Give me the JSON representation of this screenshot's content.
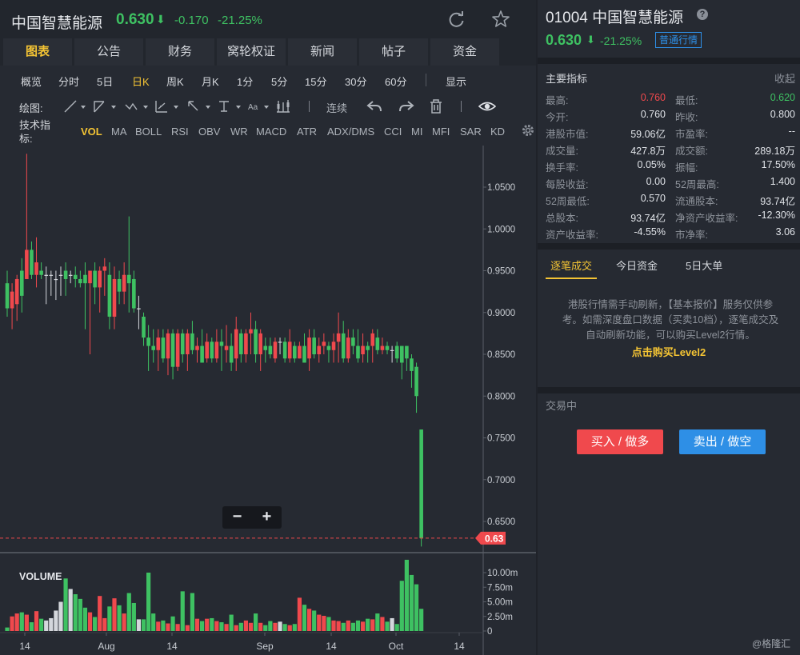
{
  "header": {
    "name": "中国智慧能源",
    "price": "0.630",
    "arrow": "⬇",
    "change": "-0.170",
    "change_pct": "-21.25%"
  },
  "tabs": [
    {
      "label": "图表",
      "active": true
    },
    {
      "label": "公告"
    },
    {
      "label": "财务"
    },
    {
      "label": "窝轮权证"
    },
    {
      "label": "新闻"
    },
    {
      "label": "帖子"
    },
    {
      "label": "资金"
    }
  ],
  "periods": [
    {
      "label": "概览"
    },
    {
      "label": "分时"
    },
    {
      "label": "5日"
    },
    {
      "label": "日K",
      "active": true
    },
    {
      "label": "周K"
    },
    {
      "label": "月K"
    },
    {
      "label": "1分"
    },
    {
      "label": "5分"
    },
    {
      "label": "15分"
    },
    {
      "label": "30分"
    },
    {
      "label": "60分"
    },
    {
      "label": "显示"
    }
  ],
  "drawbar": {
    "label": "绘图:",
    "continuous": "连续"
  },
  "indicators": {
    "label": "技术指标:",
    "items": [
      "VOL",
      "MA",
      "BOLL",
      "RSI",
      "OBV",
      "WR",
      "MACD",
      "ATR",
      "ADX/DMS",
      "CCI",
      "MI",
      "MFI",
      "SAR",
      "KD"
    ],
    "active": "VOL"
  },
  "chart_data": {
    "type": "candlestick",
    "price_axis": {
      "ticks": [
        "1.0500",
        "1.0000",
        "0.9500",
        "0.9000",
        "0.8500",
        "0.8000",
        "0.7500",
        "0.7000",
        "0.6500"
      ],
      "range": [
        0.62,
        1.08
      ]
    },
    "current_price_label": "0.63",
    "volume_label": "VOLUME",
    "volume_axis": {
      "ticks": [
        "10.00m",
        "7.50m",
        "5.00m",
        "2.50m",
        "0"
      ],
      "range": [
        0,
        13
      ]
    },
    "x_labels": [
      "14",
      "Aug",
      "14",
      "Sep",
      "14",
      "Oct",
      "14"
    ],
    "candles": [
      {
        "o": 0.935,
        "h": 0.95,
        "l": 0.895,
        "c": 0.905,
        "v": 0.6
      },
      {
        "o": 0.905,
        "h": 0.935,
        "l": 0.88,
        "c": 0.925,
        "v": 2.5
      },
      {
        "o": 0.91,
        "h": 0.945,
        "l": 0.89,
        "c": 0.94,
        "v": 3.0
      },
      {
        "o": 0.95,
        "h": 0.965,
        "l": 0.9,
        "c": 0.92,
        "v": 3.2
      },
      {
        "o": 0.94,
        "h": 1.09,
        "l": 0.94,
        "c": 0.975,
        "v": 2.8
      },
      {
        "o": 0.975,
        "h": 0.985,
        "l": 0.94,
        "c": 0.945,
        "v": 1.5
      },
      {
        "o": 0.945,
        "h": 0.99,
        "l": 0.93,
        "c": 0.96,
        "v": 3.4
      },
      {
        "o": 0.95,
        "h": 0.96,
        "l": 0.94,
        "c": 0.945,
        "v": 2.1
      },
      {
        "o": 0.945,
        "h": 0.955,
        "l": 0.91,
        "c": 0.945,
        "v": 1.8
      },
      {
        "o": 0.945,
        "h": 0.95,
        "l": 0.92,
        "c": 0.945,
        "v": 2.2
      },
      {
        "o": 0.94,
        "h": 0.95,
        "l": 0.915,
        "c": 0.94,
        "v": 3.5
      },
      {
        "o": 0.945,
        "h": 0.955,
        "l": 0.92,
        "c": 0.945,
        "v": 5.0
      },
      {
        "o": 0.95,
        "h": 0.96,
        "l": 0.92,
        "c": 0.94,
        "v": 9.0
      },
      {
        "o": 0.945,
        "h": 0.95,
        "l": 0.935,
        "c": 0.945,
        "v": 7.2
      },
      {
        "o": 0.945,
        "h": 0.955,
        "l": 0.93,
        "c": 0.94,
        "v": 6.3
      },
      {
        "o": 0.94,
        "h": 0.95,
        "l": 0.93,
        "c": 0.935,
        "v": 5.5
      },
      {
        "o": 0.945,
        "h": 0.96,
        "l": 0.88,
        "c": 0.935,
        "v": 4.0
      },
      {
        "o": 0.935,
        "h": 0.95,
        "l": 0.85,
        "c": 0.95,
        "v": 3.2
      },
      {
        "o": 0.95,
        "h": 0.96,
        "l": 0.91,
        "c": 0.93,
        "v": 2.4
      },
      {
        "o": 0.93,
        "h": 0.955,
        "l": 0.9,
        "c": 0.95,
        "v": 6.0
      },
      {
        "o": 0.95,
        "h": 0.965,
        "l": 0.92,
        "c": 0.955,
        "v": 2.2
      },
      {
        "o": 0.945,
        "h": 0.96,
        "l": 0.88,
        "c": 0.895,
        "v": 4.2
      },
      {
        "o": 0.895,
        "h": 0.955,
        "l": 0.88,
        "c": 0.94,
        "v": 5.6
      },
      {
        "o": 0.94,
        "h": 0.95,
        "l": 0.91,
        "c": 0.925,
        "v": 4.4
      },
      {
        "o": 0.925,
        "h": 0.96,
        "l": 0.91,
        "c": 0.945,
        "v": 3.0
      },
      {
        "o": 0.945,
        "h": 1.015,
        "l": 0.9,
        "c": 0.935,
        "v": 6.5
      },
      {
        "o": 0.94,
        "h": 0.95,
        "l": 0.9,
        "c": 0.905,
        "v": 4.8
      },
      {
        "o": 0.905,
        "h": 0.92,
        "l": 0.88,
        "c": 0.905,
        "v": 2.0
      },
      {
        "o": 0.895,
        "h": 0.9,
        "l": 0.86,
        "c": 0.87,
        "v": 2.0
      },
      {
        "o": 0.87,
        "h": 0.885,
        "l": 0.83,
        "c": 0.86,
        "v": 10.0
      },
      {
        "o": 0.86,
        "h": 0.88,
        "l": 0.84,
        "c": 0.855,
        "v": 3.0
      },
      {
        "o": 0.855,
        "h": 0.88,
        "l": 0.83,
        "c": 0.87,
        "v": 1.6
      },
      {
        "o": 0.87,
        "h": 0.88,
        "l": 0.84,
        "c": 0.845,
        "v": 1.8
      },
      {
        "o": 0.845,
        "h": 0.88,
        "l": 0.825,
        "c": 0.875,
        "v": 1.3
      },
      {
        "o": 0.875,
        "h": 0.88,
        "l": 0.82,
        "c": 0.835,
        "v": 2.5
      },
      {
        "o": 0.835,
        "h": 0.88,
        "l": 0.83,
        "c": 0.875,
        "v": 1.2
      },
      {
        "o": 0.875,
        "h": 0.88,
        "l": 0.84,
        "c": 0.85,
        "v": 6.8
      },
      {
        "o": 0.85,
        "h": 0.88,
        "l": 0.83,
        "c": 0.875,
        "v": 1.0
      },
      {
        "o": 0.875,
        "h": 0.89,
        "l": 0.85,
        "c": 0.855,
        "v": 6.5
      },
      {
        "o": 0.855,
        "h": 0.87,
        "l": 0.84,
        "c": 0.86,
        "v": 2.1
      },
      {
        "o": 0.86,
        "h": 0.88,
        "l": 0.84,
        "c": 0.84,
        "v": 1.7
      },
      {
        "o": 0.845,
        "h": 0.875,
        "l": 0.84,
        "c": 0.865,
        "v": 2.1
      },
      {
        "o": 0.865,
        "h": 0.87,
        "l": 0.84,
        "c": 0.845,
        "v": 2.2
      },
      {
        "o": 0.845,
        "h": 0.88,
        "l": 0.84,
        "c": 0.865,
        "v": 1.7
      },
      {
        "o": 0.865,
        "h": 0.88,
        "l": 0.83,
        "c": 0.86,
        "v": 1.5
      },
      {
        "o": 0.855,
        "h": 0.885,
        "l": 0.84,
        "c": 0.86,
        "v": 1.2
      },
      {
        "o": 0.86,
        "h": 0.875,
        "l": 0.83,
        "c": 0.84,
        "v": 2.8
      },
      {
        "o": 0.845,
        "h": 0.895,
        "l": 0.83,
        "c": 0.88,
        "v": 1.0
      },
      {
        "o": 0.875,
        "h": 0.88,
        "l": 0.84,
        "c": 0.85,
        "v": 1.4
      },
      {
        "o": 0.85,
        "h": 0.88,
        "l": 0.84,
        "c": 0.875,
        "v": 1.8
      },
      {
        "o": 0.875,
        "h": 0.9,
        "l": 0.85,
        "c": 0.88,
        "v": 1.4
      },
      {
        "o": 0.88,
        "h": 0.89,
        "l": 0.84,
        "c": 0.85,
        "v": 3.0
      },
      {
        "o": 0.85,
        "h": 0.88,
        "l": 0.83,
        "c": 0.875,
        "v": 1.4
      },
      {
        "o": 0.86,
        "h": 0.87,
        "l": 0.84,
        "c": 0.855,
        "v": 1.0
      },
      {
        "o": 0.86,
        "h": 0.87,
        "l": 0.845,
        "c": 0.85,
        "v": 1.7
      },
      {
        "o": 0.845,
        "h": 0.87,
        "l": 0.84,
        "c": 0.865,
        "v": 1.4
      },
      {
        "o": 0.865,
        "h": 0.87,
        "l": 0.85,
        "c": 0.865,
        "v": 1.6
      },
      {
        "o": 0.865,
        "h": 0.87,
        "l": 0.84,
        "c": 0.845,
        "v": 1.2
      },
      {
        "o": 0.845,
        "h": 0.88,
        "l": 0.84,
        "c": 0.865,
        "v": 1.0
      },
      {
        "o": 0.86,
        "h": 0.865,
        "l": 0.84,
        "c": 0.845,
        "v": 1.2
      },
      {
        "o": 0.845,
        "h": 0.865,
        "l": 0.845,
        "c": 0.86,
        "v": 5.7
      },
      {
        "o": 0.86,
        "h": 0.875,
        "l": 0.84,
        "c": 0.84,
        "v": 4.5
      },
      {
        "o": 0.845,
        "h": 0.88,
        "l": 0.83,
        "c": 0.87,
        "v": 3.8
      },
      {
        "o": 0.87,
        "h": 0.88,
        "l": 0.845,
        "c": 0.85,
        "v": 3.5
      },
      {
        "o": 0.85,
        "h": 0.87,
        "l": 0.84,
        "c": 0.86,
        "v": 2.8
      },
      {
        "o": 0.86,
        "h": 0.875,
        "l": 0.85,
        "c": 0.865,
        "v": 2.6
      },
      {
        "o": 0.86,
        "h": 0.865,
        "l": 0.84,
        "c": 0.855,
        "v": 2.4
      },
      {
        "o": 0.855,
        "h": 0.875,
        "l": 0.84,
        "c": 0.865,
        "v": 1.8
      },
      {
        "o": 0.865,
        "h": 0.9,
        "l": 0.84,
        "c": 0.875,
        "v": 1.7
      },
      {
        "o": 0.875,
        "h": 0.89,
        "l": 0.84,
        "c": 0.845,
        "v": 1.4
      },
      {
        "o": 0.845,
        "h": 0.88,
        "l": 0.84,
        "c": 0.87,
        "v": 1.8
      },
      {
        "o": 0.87,
        "h": 0.88,
        "l": 0.85,
        "c": 0.86,
        "v": 1.4
      },
      {
        "o": 0.86,
        "h": 0.88,
        "l": 0.84,
        "c": 0.845,
        "v": 1.8
      },
      {
        "o": 0.85,
        "h": 0.875,
        "l": 0.84,
        "c": 0.86,
        "v": 1.6
      },
      {
        "o": 0.86,
        "h": 0.865,
        "l": 0.84,
        "c": 0.855,
        "v": 2.1
      },
      {
        "o": 0.86,
        "h": 0.88,
        "l": 0.84,
        "c": 0.875,
        "v": 2.0
      },
      {
        "o": 0.87,
        "h": 0.88,
        "l": 0.85,
        "c": 0.855,
        "v": 3.0
      },
      {
        "o": 0.855,
        "h": 0.87,
        "l": 0.85,
        "c": 0.86,
        "v": 2.4
      },
      {
        "o": 0.86,
        "h": 0.865,
        "l": 0.85,
        "c": 0.855,
        "v": 1.6
      },
      {
        "o": 0.855,
        "h": 0.86,
        "l": 0.84,
        "c": 0.855,
        "v": 2.2
      },
      {
        "o": 0.86,
        "h": 0.865,
        "l": 0.84,
        "c": 0.845,
        "v": 1.2
      },
      {
        "o": 0.86,
        "h": 0.86,
        "l": 0.82,
        "c": 0.84,
        "v": 8.6
      },
      {
        "o": 0.86,
        "h": 0.86,
        "l": 0.83,
        "c": 0.845,
        "v": 12.2
      },
      {
        "o": 0.845,
        "h": 0.85,
        "l": 0.81,
        "c": 0.83,
        "v": 9.6
      },
      {
        "o": 0.835,
        "h": 0.84,
        "l": 0.78,
        "c": 0.8,
        "v": 8.0
      },
      {
        "o": 0.76,
        "h": 0.76,
        "l": 0.62,
        "c": 0.63,
        "v": 3.8
      }
    ]
  },
  "right": {
    "code_name": "01004 中国智慧能源",
    "help_icon": "?",
    "price": "0.630",
    "arrow": "⬇",
    "change_pct": "-21.25%",
    "badge": "普通行情",
    "indicators_title": "主要指标",
    "collapse": "收起",
    "rows": [
      {
        "l1": "最高:",
        "v1": "0.760",
        "c1": "red",
        "l2": "最低:",
        "v2": "0.620",
        "c2": "green"
      },
      {
        "l1": "今开:",
        "v1": "0.760",
        "l2": "昨收:",
        "v2": "0.800"
      },
      {
        "l1": "港股市值:",
        "v1": "59.06亿",
        "l2": "市盈率:",
        "v2": "--"
      },
      {
        "l1": "成交量:",
        "v1": "427.8万",
        "l2": "成交额:",
        "v2": "289.18万"
      },
      {
        "l1": "换手率:",
        "v1": "0.05%",
        "l2": "振幅:",
        "v2": "17.50%"
      },
      {
        "l1": "每股收益:",
        "v1": "0.00",
        "l2": "52周最高:",
        "v2": "1.400"
      },
      {
        "l1": "52周最低:",
        "v1": "0.570",
        "l2": "流通股本:",
        "v2": "93.74亿"
      },
      {
        "l1": "总股本:",
        "v1": "93.74亿",
        "l2": "净资产收益率:",
        "v2": "-12.30%"
      },
      {
        "l1": "资产收益率:",
        "v1": "-4.55%",
        "l2": "市净率:",
        "v2": "3.06"
      }
    ],
    "trade_tabs": [
      "逐笔成交",
      "今日资金",
      "5日大单"
    ],
    "notice": "港股行情需手动刷新，【基本报价】服务仅供参考。如需深度盘口数据（买卖10档），逐笔成交及自动刷新功能，可以购买Level2行情。",
    "buy_link": "点击购买Level2",
    "status": "交易中",
    "buy_btn": "买入 / 做多",
    "sell_btn": "卖出 / 做空"
  },
  "zoom": {
    "minus": "−",
    "plus": "+"
  },
  "watermark": "@格隆汇",
  "colors": {
    "up": "#f0494d",
    "down": "#3ec162",
    "flat": "#d4d7dc",
    "accent": "#f4c434",
    "blue": "#2e8fe6"
  }
}
